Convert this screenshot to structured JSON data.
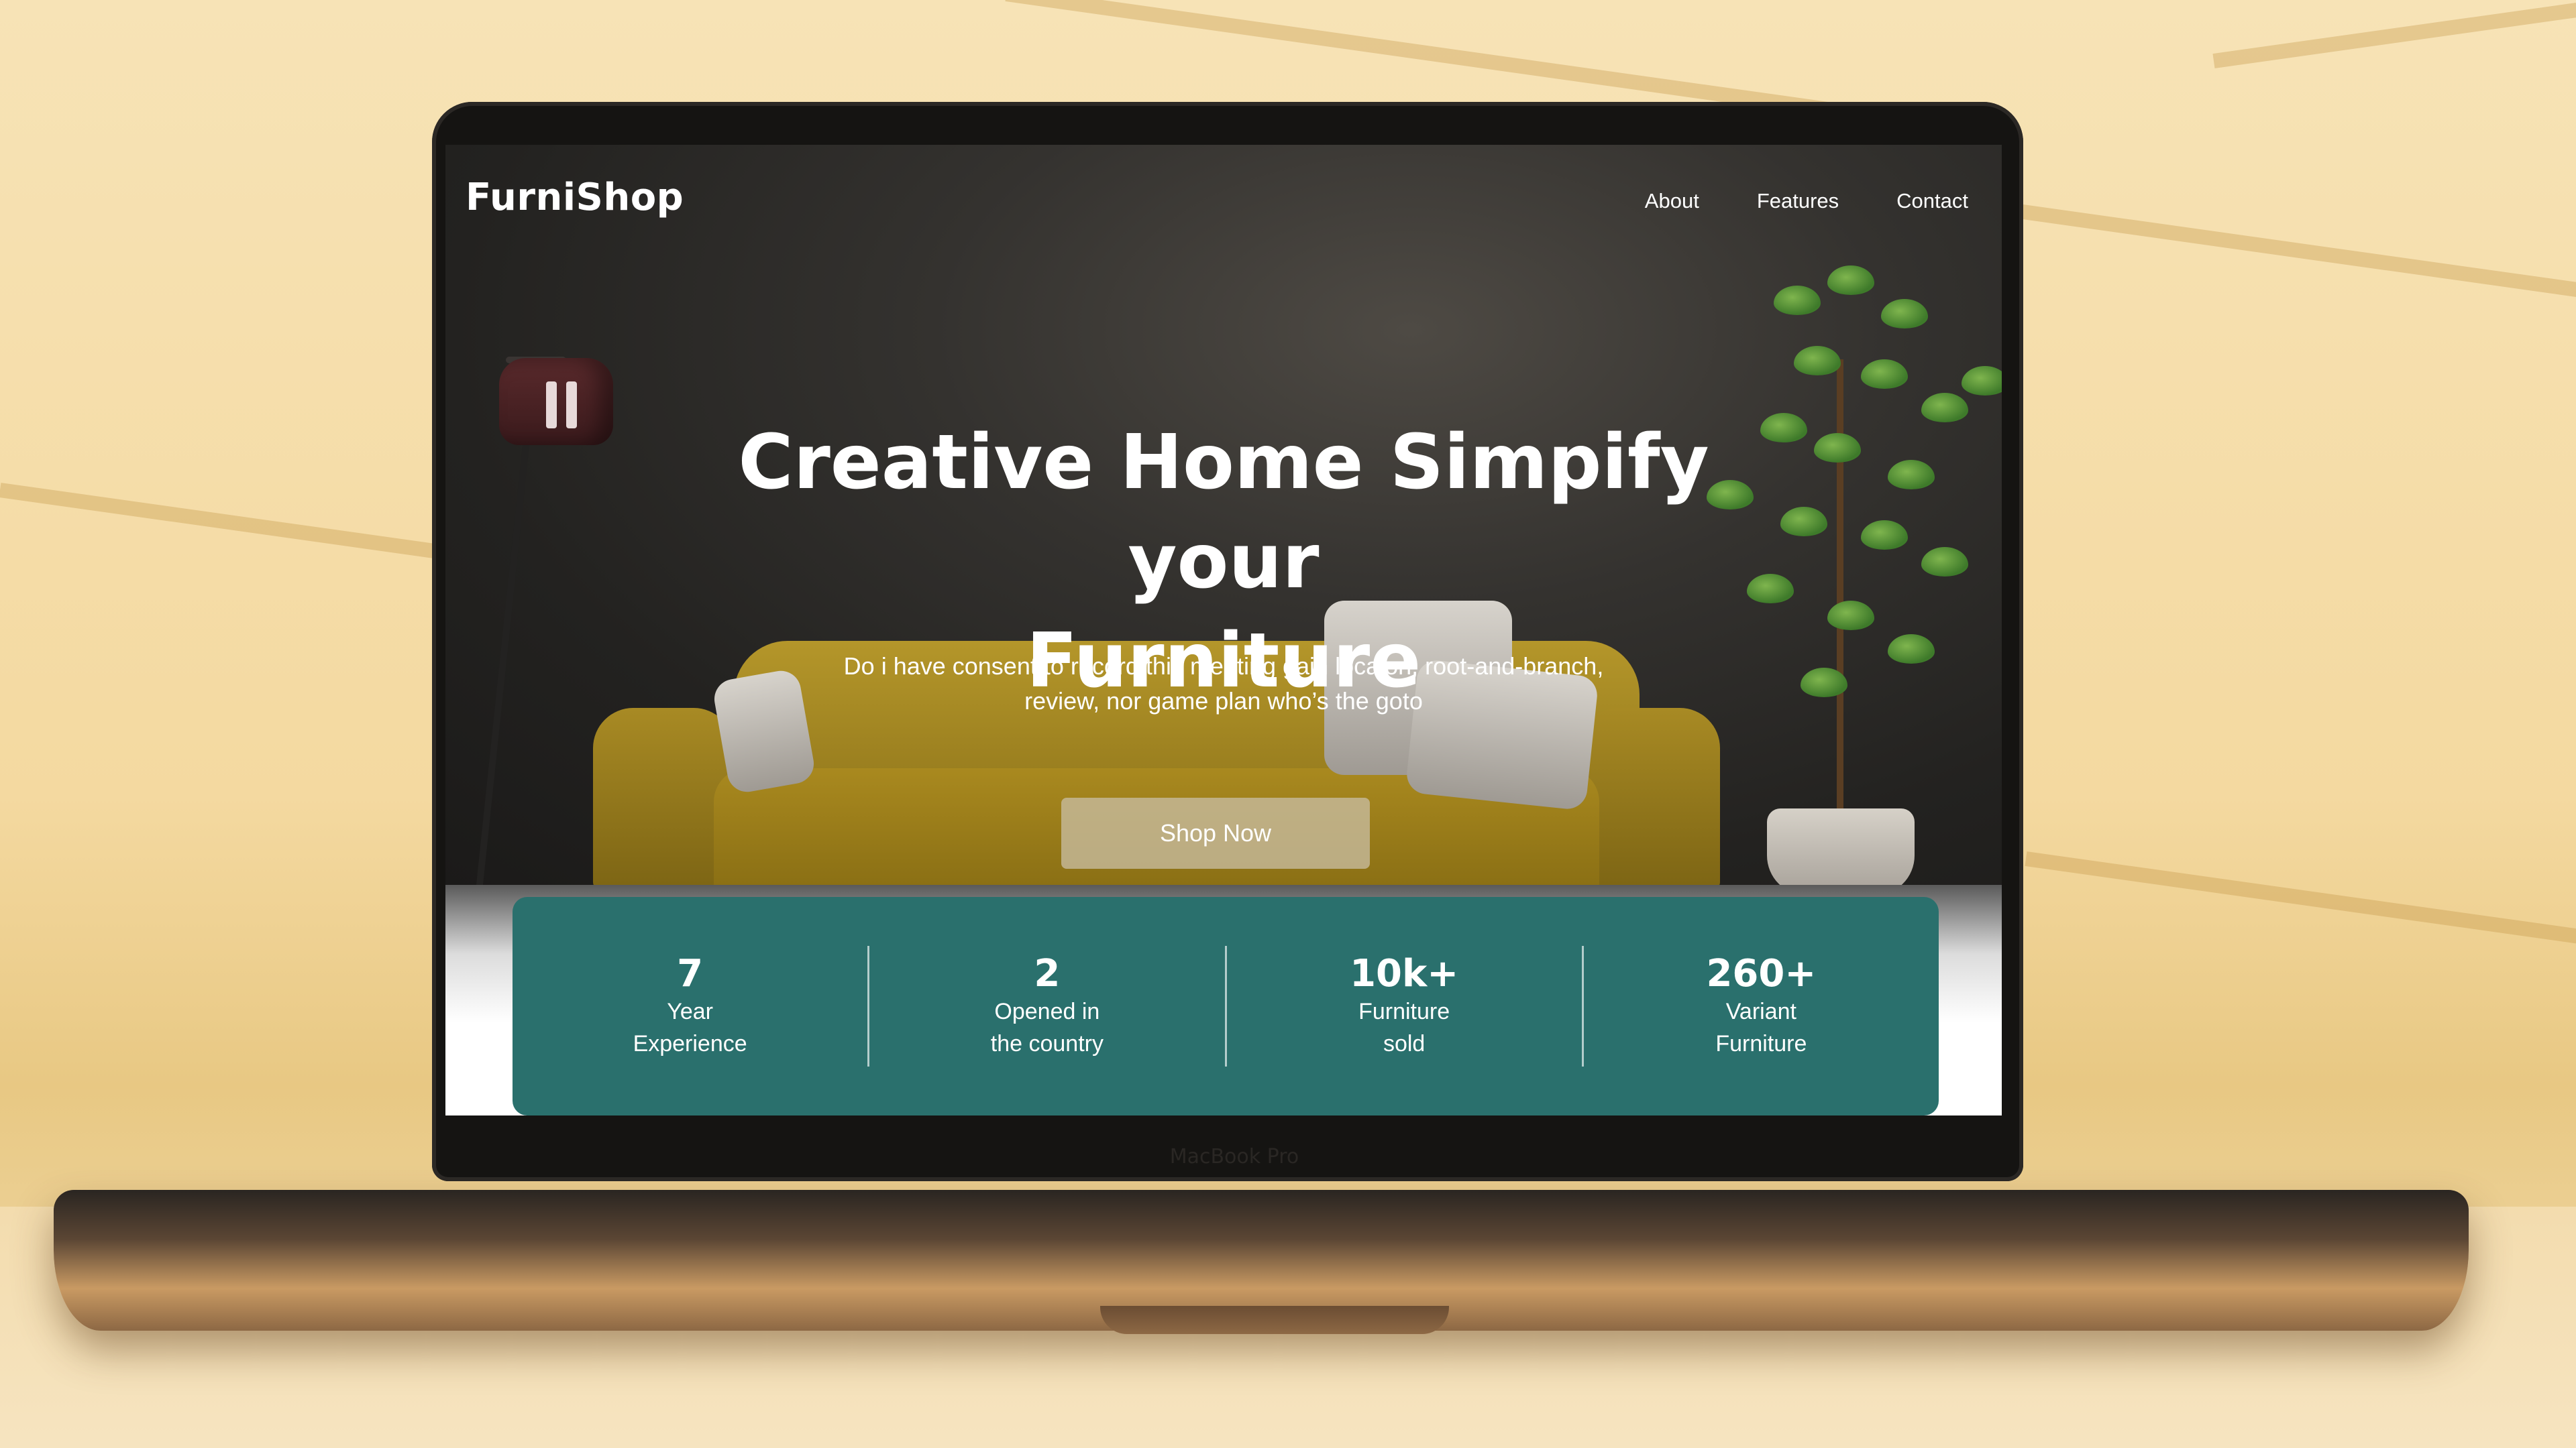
{
  "site": {
    "brand": "FurniShop",
    "nav": [
      {
        "label": "About"
      },
      {
        "label": "Features"
      },
      {
        "label": "Contact"
      }
    ]
  },
  "hero": {
    "title_line1": "Creative Home Simpify your",
    "title_line2": "Furniture",
    "subtitle": "Do i have consent to record this meeting gain locaion, root-and-branch, review, nor game plan who’s the goto",
    "cta_label": "Shop Now"
  },
  "stats": [
    {
      "value": "7",
      "label": "Year\nExperience"
    },
    {
      "value": "2",
      "label": "Opened in\nthe country"
    },
    {
      "value": "10k+",
      "label": "Furniture\nsold"
    },
    {
      "value": "260+",
      "label": "Variant\nFurniture"
    }
  ],
  "device": {
    "bezel_label": "MacBook Pro"
  },
  "colors": {
    "accent": "#2a706d",
    "hero_bg": "#2b2a28",
    "backdrop": "#f4d9a0"
  }
}
